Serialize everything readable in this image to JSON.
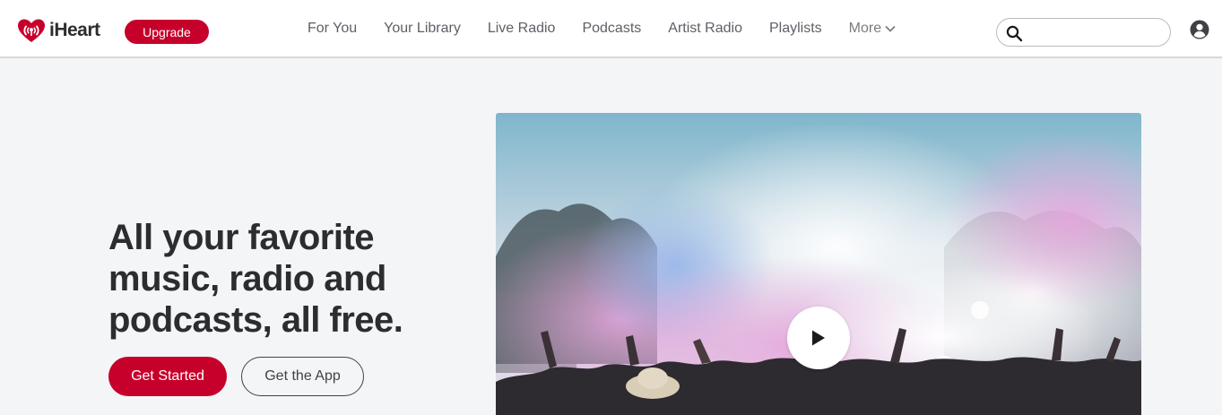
{
  "brand": {
    "name": "iHeart",
    "accent": "#c6002b"
  },
  "header": {
    "upgrade_label": "Upgrade",
    "nav": [
      {
        "label": "For You"
      },
      {
        "label": "Your Library"
      },
      {
        "label": "Live Radio"
      },
      {
        "label": "Podcasts"
      },
      {
        "label": "Artist Radio"
      },
      {
        "label": "Playlists"
      }
    ],
    "more_label": "More",
    "search": {
      "value": "",
      "placeholder": ""
    }
  },
  "hero": {
    "headline": "All your favorite music, radio and podcasts, all free.",
    "primary_cta": "Get Started",
    "secondary_cta": "Get the App"
  },
  "icons": {
    "logo": "iheart-logo-icon",
    "search": "search-icon",
    "account": "account-icon",
    "more": "chevron-down-icon",
    "play": "play-icon"
  }
}
